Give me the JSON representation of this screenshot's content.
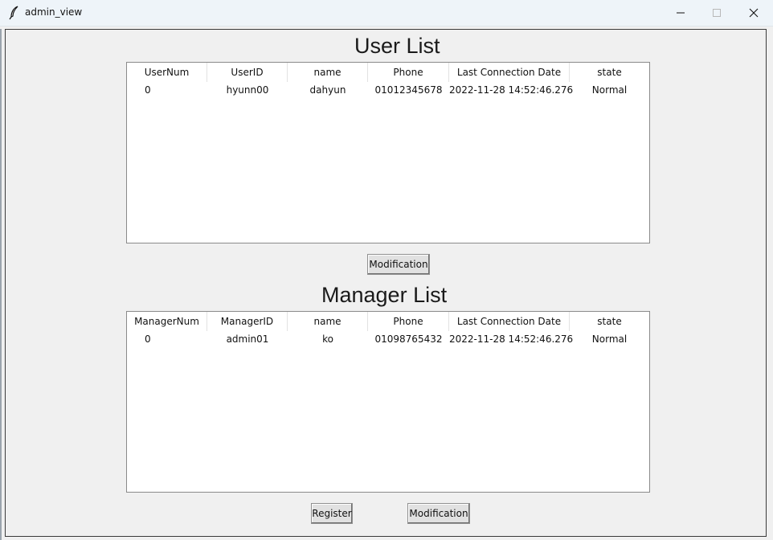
{
  "window": {
    "title": "admin_view",
    "icon": "feather-icon"
  },
  "user_list": {
    "title": "User List",
    "columns": [
      "UserNum",
      "UserID",
      "name",
      "Phone",
      "Last Connection Date",
      "state"
    ],
    "rows": [
      [
        "0",
        "hyunn00",
        "dahyun",
        "01012345678",
        "2022-11-28 14:52:46.276",
        "Normal"
      ]
    ],
    "modification_label": "Modification"
  },
  "manager_list": {
    "title": "Manager List",
    "columns": [
      "ManagerNum",
      "ManagerID",
      "name",
      "Phone",
      "Last Connection Date",
      "state"
    ],
    "rows": [
      [
        "0",
        "admin01",
        "ko",
        "01098765432",
        "2022-11-28 14:52:46.276",
        "Normal"
      ]
    ],
    "register_label": "Register",
    "modification_label": "Modification"
  }
}
